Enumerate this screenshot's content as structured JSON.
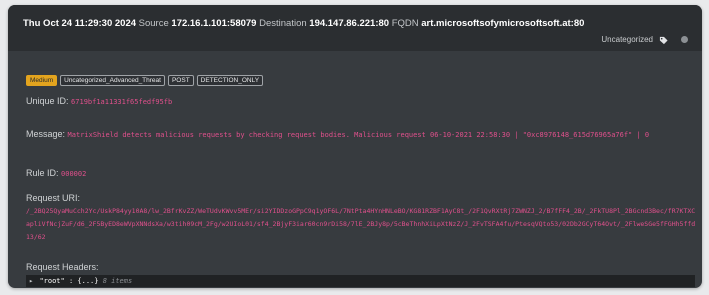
{
  "header": {
    "timestamp": "Thu Oct 24 11:29:30 2024",
    "source_label": "Source",
    "source_value": "172.16.1.101:58079",
    "destination_label": "Destination",
    "destination_value": "194.147.86.221:80",
    "fqdn_label": "FQDN",
    "fqdn_value": "art.microsoftsofymicrosoftsoft.at:80",
    "category": "Uncategorized",
    "category_icon": "tag-icon",
    "menu_icon": "dot-icon"
  },
  "badges": [
    "Medium",
    "Uncategorized_Advanced_Threat",
    "POST",
    "DETECTION_ONLY"
  ],
  "unique_id": {
    "label": "Unique ID:",
    "value": "6719bf1a11331f65fedf95fb"
  },
  "message": {
    "label": "Message:",
    "value": "MatrixShield detects malicious requests by checking request bodies. Malicious request 06-10-2021 22:58:30 | \"0xc8976148_615d76965a76f\" | 0"
  },
  "rule_id": {
    "label": "Rule ID:",
    "value": "000002"
  },
  "request_uri": {
    "label": "Request URI:",
    "value": "/_2BQ25QyaMuCch2Yc/UskP84yy10A8/lw_2BfrKvZZ/WeTUdvKWvv5MEr/si2YIDDzoGPpC9q1yOF6L/7NtPta4HYnHNLeBO/KG81RZBF1AyC8t_/2F1QvRXtRj7ZWNZJ_2/B7fFF4_2B/_2FkTU8Pl_2BGcnd3Bec/fR7KTXCapliVfNcjZuF/d6_2F5ByED8eWVpXNNdsXa/w3tih09cM_2Fg/w2UIoL01/sf4_2BjyF3iar60cn9rDi58/7lE_2BJy8p/5cBeThnhXiLpXtNzZ/J_2FvTSFA4fu/PtesqVQto53/02Db2GCyT64Ovt/_2FlweSGe5fFGHh5ffd13/62"
  },
  "request_headers": {
    "label": "Request Headers:",
    "root_key": "\"root\"",
    "root_preview": "{...}",
    "root_count": "8 items"
  }
}
